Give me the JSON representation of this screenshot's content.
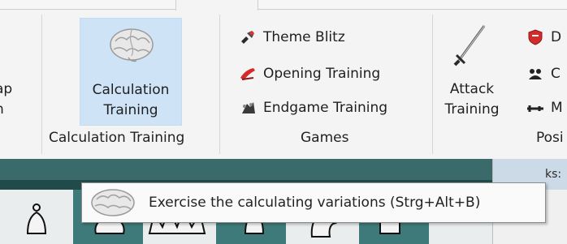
{
  "ribbon": {
    "partial_group": {
      "label_line1": "ap",
      "label_line2": "n"
    },
    "calculation_group": {
      "button_line1": "Calculation",
      "button_line2": "Training",
      "group_label": "Calculation Training"
    },
    "games_group": {
      "items": [
        {
          "label": "Theme Blitz",
          "icon": "theme-blitz-icon"
        },
        {
          "label": "Opening Training",
          "icon": "opening-training-icon"
        },
        {
          "label": "Endgame Training",
          "icon": "endgame-training-icon"
        }
      ],
      "group_label": "Games"
    },
    "position_group": {
      "attack_line1": "Attack",
      "attack_line2": "Training",
      "items": [
        {
          "label": "D",
          "icon": "shield-icon"
        },
        {
          "label": "C",
          "icon": "chess-piece-icon"
        },
        {
          "label": "M",
          "icon": "slider-icon"
        }
      ],
      "group_label": "Posi"
    }
  },
  "right_pane": {
    "header": "ks:"
  },
  "tooltip": {
    "text": "Exercise the calculating variations (Strg+Alt+B)"
  },
  "colors": {
    "selected_button": "#cfe3f7",
    "board_dark": "#3f7a7a",
    "board_light": "#e9eded"
  }
}
